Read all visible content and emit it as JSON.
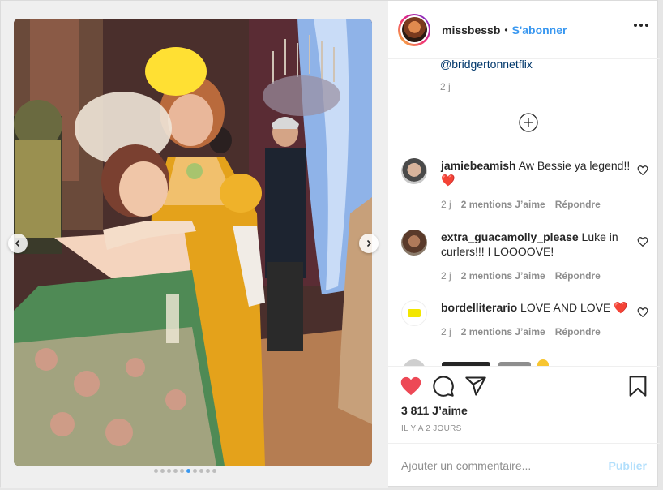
{
  "header": {
    "username": "missbessb",
    "separator": "•",
    "follow_label": "S'abonner"
  },
  "caption": {
    "mention": "@bridgertonnetflix",
    "time": "2 j"
  },
  "comments": [
    {
      "username": "jamiebeamish",
      "text": "Aw Bessie ya legend!! ❤️",
      "time": "2 j",
      "likes": "2 mentions J’aime",
      "reply": "Répondre"
    },
    {
      "username": "extra_guacamolly_please",
      "text": "Luke in curlers!!! I LOOOOVE!",
      "time": "2 j",
      "likes": "2 mentions J’aime",
      "reply": "Répondre"
    },
    {
      "username": "bordelliterario",
      "text": "LOVE AND LOVE ❤️",
      "time": "2 j",
      "likes": "2 mentions J’aime",
      "reply": "Répondre"
    }
  ],
  "stats": {
    "likes": "3 811 J’aime",
    "date": "IL Y A 2 JOURS"
  },
  "add_comment": {
    "placeholder": "Ajouter un commentaire...",
    "publish_label": "Publier"
  },
  "carousel": {
    "slide_count": 10,
    "active_index": 5
  },
  "colors": {
    "accent": "#3897f0",
    "like_red": "#ed4956",
    "muted": "#8e8e8e",
    "publish_disabled": "#b2dffc"
  }
}
